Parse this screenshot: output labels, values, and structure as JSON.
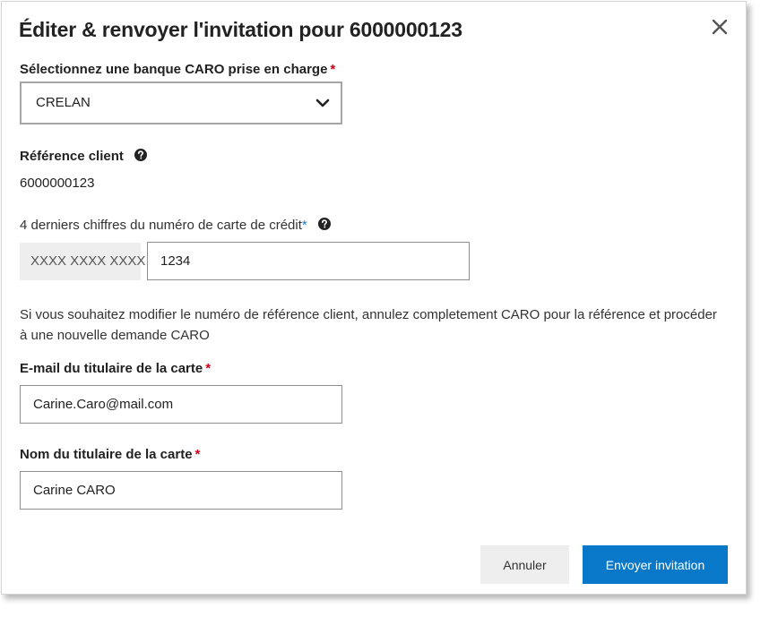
{
  "dialog": {
    "title": "Éditer & renvoyer l'invitation pour 6000000123",
    "close_icon": "close-icon"
  },
  "bank": {
    "label": "Sélectionnez une banque CARO prise en charge",
    "required_mark": "*",
    "selected_value": "CRELAN"
  },
  "reference": {
    "label": "Référence client",
    "value": "6000000123",
    "help_icon": "question-circle-icon"
  },
  "card_digits": {
    "label": "4 derniers chiffres du numéro de carte de crédit",
    "required_mark": "*",
    "prefix": "XXXX XXXX XXXX",
    "value": "1234",
    "help_icon": "question-circle-icon"
  },
  "info": {
    "text": "Si vous souhaitez modifier le numéro de référence client, annulez completement CARO pour la référence et procéder à une nouvelle demande CARO"
  },
  "email": {
    "label": "E-mail du titulaire de la carte",
    "required_mark": "*",
    "value": "Carine.Caro@mail.com"
  },
  "holder_name": {
    "label": "Nom du titulaire de la carte",
    "required_mark": "*",
    "value": "Carine CARO"
  },
  "actions": {
    "cancel_label": "Annuler",
    "send_label": "Envoyer invitation"
  },
  "colors": {
    "primary": "#0a78c8",
    "required": "#d0021b",
    "required_blue": "#1f7ac2",
    "secondary_button": "#eeeeee"
  }
}
